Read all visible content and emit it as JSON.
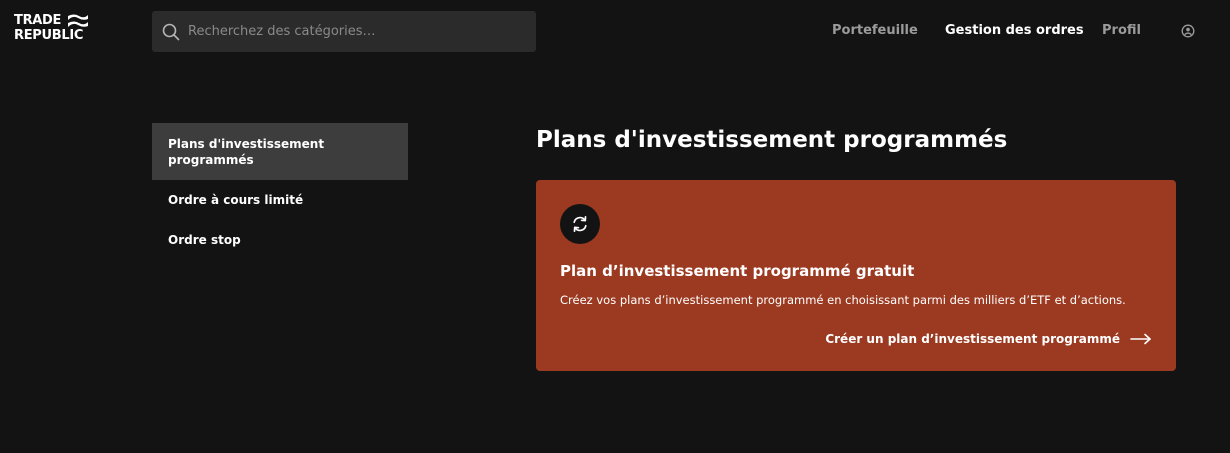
{
  "brand": {
    "logo_line1": "TRADE",
    "logo_line2": "REPUBLIC"
  },
  "search": {
    "placeholder": "Recherchez des catégories…",
    "value": ""
  },
  "nav": {
    "items": [
      {
        "label": "Portefeuille",
        "active": false
      },
      {
        "label": "Gestion des ordres",
        "active": true
      },
      {
        "label": "Profil",
        "active": false
      }
    ],
    "account_icon": "account-circle-icon"
  },
  "sidebar": {
    "items": [
      {
        "label_line1": "Plans d'investissement",
        "label_line2": "programmés",
        "active": true
      },
      {
        "label": "Ordre à cours limité",
        "active": false
      },
      {
        "label": "Ordre stop",
        "active": false
      }
    ]
  },
  "main": {
    "title": "Plans d'investissement programmés",
    "card": {
      "icon": "repeat-icon",
      "title": "Plan d’investissement programmé gratuit",
      "description": "Créez vos plans d’investissement programmé en choisissant parmi des milliers d’ETF et d’actions.",
      "cta_label": "Créer un plan d’investissement programmé",
      "cta_icon": "arrow-right-icon",
      "background_color": "#9c3a21"
    }
  },
  "colors": {
    "background": "#131313",
    "search_background": "#2b2b2b",
    "sidebar_active": "#3d3d3d",
    "nav_inactive": "#9b9b9b",
    "accent_card": "#9c3a21"
  }
}
